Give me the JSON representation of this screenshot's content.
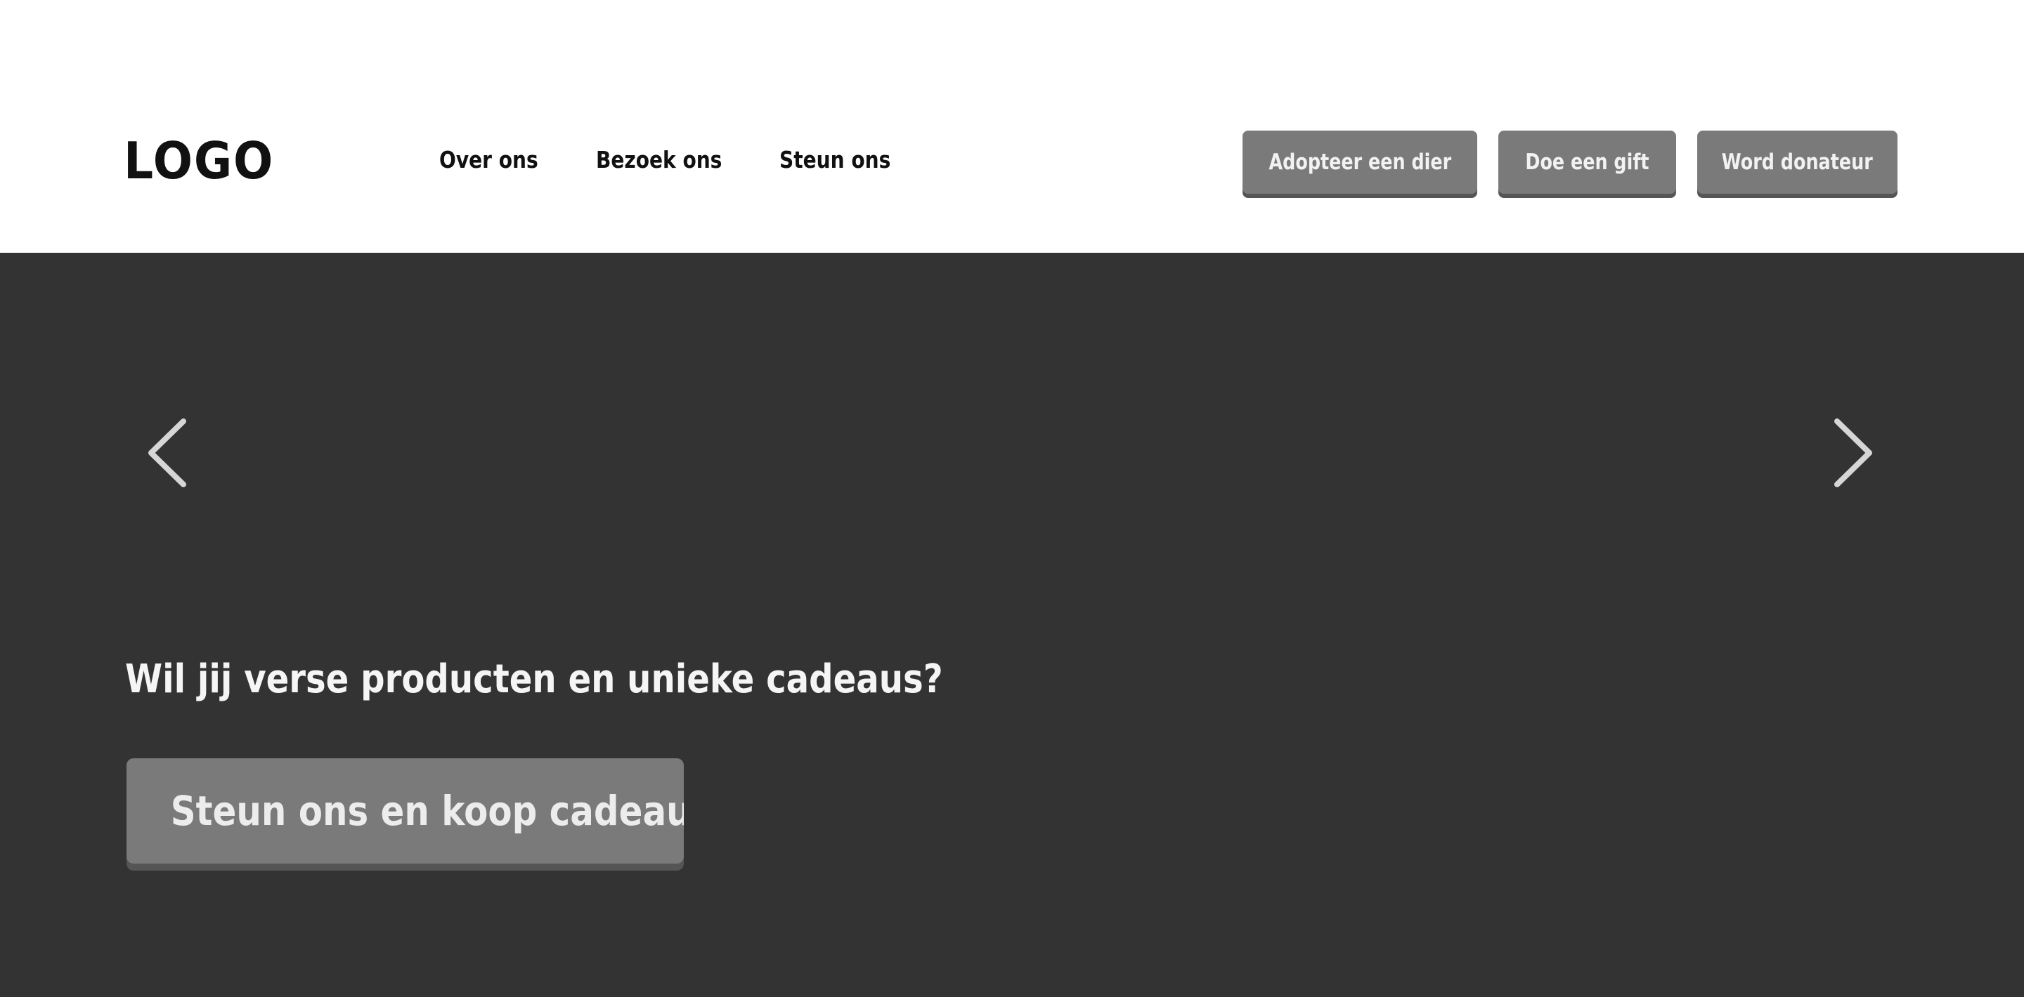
{
  "header": {
    "logo": "LOGO",
    "nav": [
      {
        "label": "Over ons"
      },
      {
        "label": "Bezoek ons"
      },
      {
        "label": "Steun ons"
      }
    ],
    "cta_buttons": [
      {
        "label": "Adopteer een dier"
      },
      {
        "label": "Doe een gift"
      },
      {
        "label": "Word donateur"
      }
    ]
  },
  "hero": {
    "prev_icon": "chevron-left-icon",
    "next_icon": "chevron-right-icon",
    "heading": "Wil jij verse producten en unieke cadeaus?",
    "button_label": "Steun ons en koop cadeaus"
  },
  "colors": {
    "header_background": "#ffffff",
    "hero_background": "#333333",
    "button_background": "#7a7a7a",
    "button_shadow": "#555555",
    "text_dark": "#111111",
    "text_light": "#f5f5f5"
  }
}
